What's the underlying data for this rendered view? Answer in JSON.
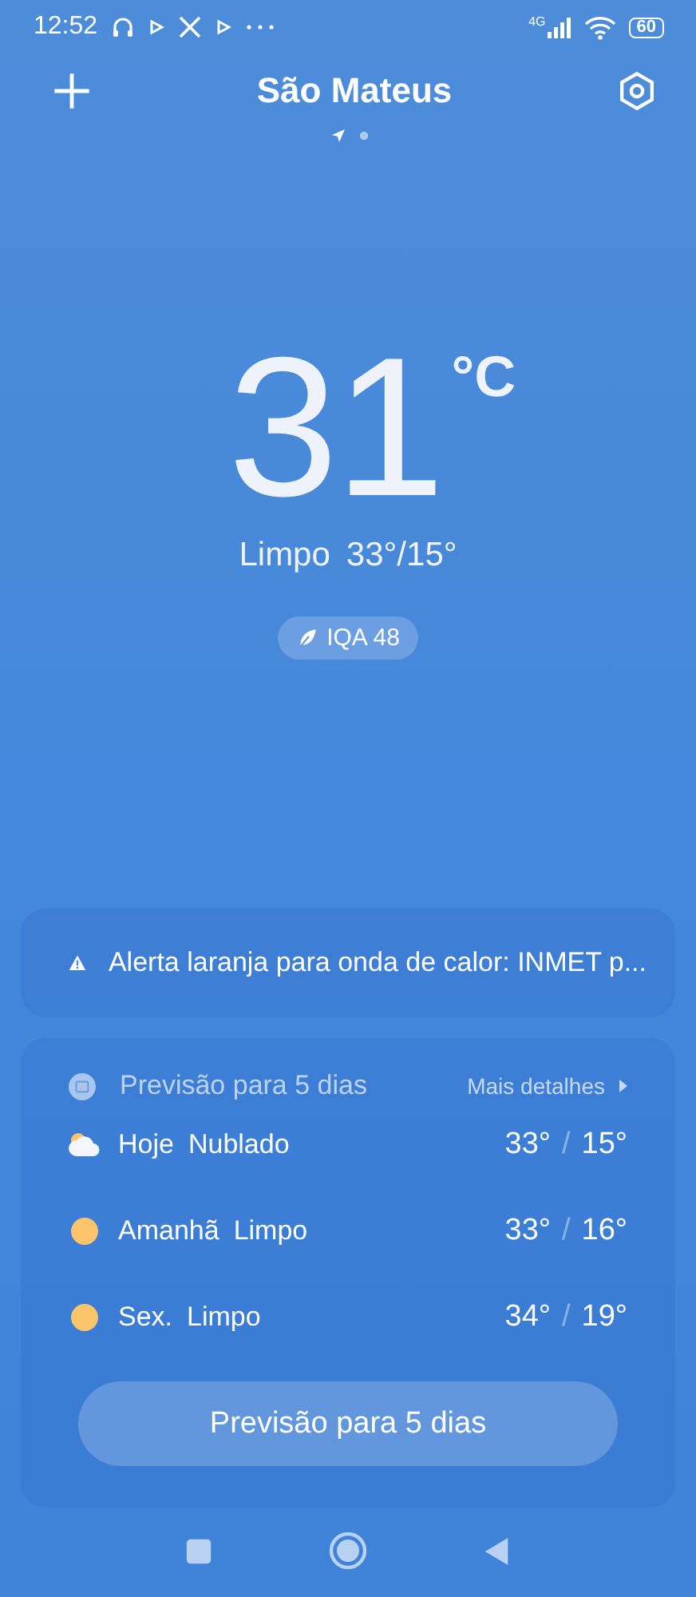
{
  "status_bar": {
    "time": "12:52",
    "network": "4G",
    "battery": "60"
  },
  "header": {
    "city": "São Mateus",
    "pages": [
      {
        "kind": "location",
        "selected": true
      },
      {
        "kind": "dot",
        "selected": false
      }
    ]
  },
  "current": {
    "temperature": "31",
    "unit": "°C",
    "condition": "Limpo",
    "high_low": "33°/15°",
    "aqi": "IQA 48"
  },
  "alert": {
    "text": "Alerta laranja para onda de calor: INMET p..."
  },
  "forecast": {
    "title": "Previsão para 5 dias",
    "more": "Mais detalhes",
    "days": [
      {
        "kind": "cloudy",
        "day": "Hoje",
        "condition": "Nublado",
        "high": "33°",
        "separator": "/",
        "low": "15°"
      },
      {
        "kind": "sunny",
        "day": "Amanhã",
        "condition": "Limpo",
        "high": "33°",
        "separator": "/",
        "low": "16°"
      },
      {
        "kind": "sunny",
        "day": "Sex.",
        "condition": "Limpo",
        "high": "34°",
        "separator": "/",
        "low": "19°"
      }
    ],
    "button": "Previsão para 5 dias"
  }
}
